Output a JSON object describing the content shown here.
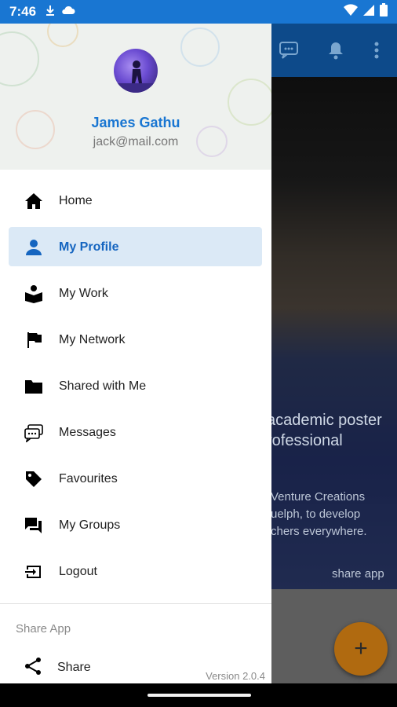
{
  "status_bar": {
    "time": "7:46"
  },
  "background": {
    "headline": [
      "academic poster",
      "rofessional"
    ],
    "body": [
      "Venture Creations",
      "uelph, to develop",
      "chers everywhere."
    ],
    "share_label": "share app",
    "fab_label": "+"
  },
  "drawer": {
    "user": {
      "name": "James Gathu",
      "email": "jack@mail.com"
    },
    "menu": [
      {
        "label": "Home",
        "icon": "home-icon"
      },
      {
        "label": "My Profile",
        "icon": "person-icon",
        "active": true
      },
      {
        "label": "My Work",
        "icon": "book-person-icon"
      },
      {
        "label": "My Network",
        "icon": "flag-icon"
      },
      {
        "label": "Shared with Me",
        "icon": "folder-icon"
      },
      {
        "label": "Messages",
        "icon": "chat-bubbles-icon"
      },
      {
        "label": "Favourites",
        "icon": "tag-icon"
      },
      {
        "label": "My Groups",
        "icon": "forum-icon"
      },
      {
        "label": "Logout",
        "icon": "logout-icon"
      }
    ],
    "section_label": "Share App",
    "share_label": "Share",
    "version": "Version 2.0.4"
  },
  "colors": {
    "primary": "#1976d2",
    "active_bg": "#dbe9f6",
    "fab": "#b06a10"
  }
}
